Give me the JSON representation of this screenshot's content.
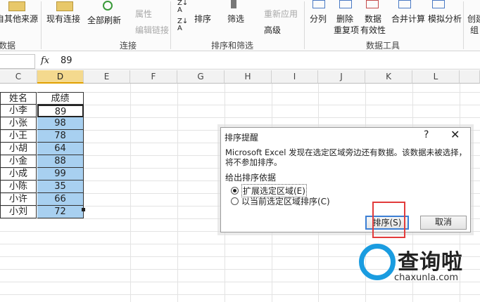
{
  "ribbon": {
    "buttons": [
      {
        "label": "自其他来源"
      },
      {
        "label": "现有连接"
      },
      {
        "label": "全部刷新"
      },
      {
        "label": "属性"
      },
      {
        "label": "编辑链接"
      },
      {
        "label": "排序"
      },
      {
        "label": "筛选"
      },
      {
        "label": "重新应用"
      },
      {
        "label": "高级"
      },
      {
        "label": "分列"
      },
      {
        "label": "删除"
      },
      {
        "label": "重复项"
      },
      {
        "label": "数据"
      },
      {
        "label": "有效性"
      },
      {
        "label": "合并计算"
      },
      {
        "label": "模拟分析"
      },
      {
        "label": "创建"
      },
      {
        "label": "组"
      }
    ],
    "groups": [
      "数据",
      "连接",
      "排序和筛选",
      "数据工具"
    ]
  },
  "formula_bar": {
    "fx": "fx",
    "value": "89"
  },
  "columns": [
    "C",
    "D",
    "E",
    "F",
    "G",
    "H",
    "I",
    "J",
    "K",
    "L"
  ],
  "table": {
    "headers": [
      "姓名",
      "成绩"
    ],
    "rows": [
      {
        "name": "小李",
        "score": "89"
      },
      {
        "name": "小张",
        "score": "98"
      },
      {
        "name": "小王",
        "score": "78"
      },
      {
        "name": "小胡",
        "score": "64"
      },
      {
        "name": "小金",
        "score": "88"
      },
      {
        "name": "小成",
        "score": "99"
      },
      {
        "name": "小陈",
        "score": "35"
      },
      {
        "name": "小许",
        "score": "66"
      },
      {
        "name": "小刘",
        "score": "72"
      }
    ]
  },
  "dialog": {
    "title": "排序提醒",
    "help": "?",
    "close": "✕",
    "message": "Microsoft Excel 发现在选定区域旁边还有数据。该数据未被选择，将不参加排序。",
    "group_label": "给出排序依据",
    "option1": "扩展选定区域(E)",
    "option2": "以当前选定区域排序(C)",
    "sort_button": "排序(S)",
    "cancel_button": "取消"
  },
  "watermark": {
    "text": "查询啦",
    "url": "chaxunla.com"
  },
  "colors": {
    "selection": "#a8d0f0",
    "highlight_box": "#e23b3b",
    "brand": "#1a9ce0"
  }
}
